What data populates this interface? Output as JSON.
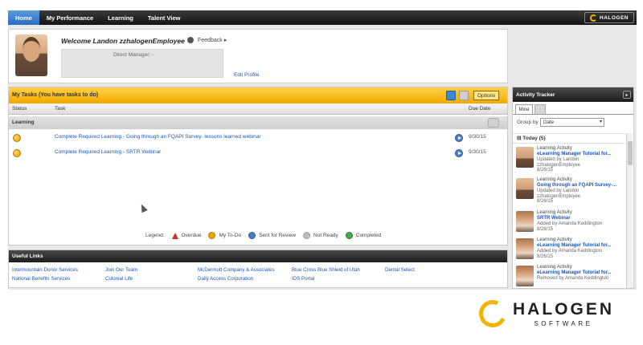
{
  "nav": {
    "tabs": [
      "Home",
      "My Performance",
      "Learning",
      "Talent View"
    ],
    "logo": "HALOGEN"
  },
  "welcome": {
    "title": "Welcome Landon zzhalogenEmployee",
    "feedback": "Feedback",
    "manager_label": "Direct Manager: -",
    "edit_profile": "Edit Profile"
  },
  "tasks": {
    "title": "My Tasks (You have tasks to do)",
    "options": "Options",
    "columns": {
      "status": "Status",
      "task": "Task",
      "due": "Due Date"
    },
    "group": "Learning",
    "rows": [
      {
        "task": "Complete Required Learning - Going through an FQAPI Survey- lessons learned webinar",
        "due": "9/30/15"
      },
      {
        "task": "Complete Required Learning - SRTR Webinar",
        "due": "9/30/15"
      }
    ],
    "legend": {
      "label": "Legend:",
      "overdue": "Overdue",
      "todo": "My To-Do",
      "review": "Sent for Review",
      "not_ready": "Not Ready",
      "completed": "Completed"
    }
  },
  "links": {
    "title": "Useful Links",
    "items": [
      "Intermountain Donor Services",
      "Join Our Team",
      "McDermott Company & Associates",
      "Blue Cross Blue Shield of Utah",
      "Dental Select",
      "National Benefits Services",
      "Colonial Life",
      "Daily Access Corporation",
      "IDS Portal"
    ]
  },
  "tracker": {
    "title": "Activity Tracker",
    "tab_mine": "Mine",
    "group_by_label": "Group by",
    "group_by_value": "Date",
    "today": "Today (5)",
    "items": [
      {
        "type": "Learning Activity",
        "title": "eLearning Manager Tutorial for...",
        "by": "Updated by Landon zzhalogenEmployee",
        "date": "8/26/15"
      },
      {
        "type": "Learning Activity",
        "title": "Going through an FQAPI Survey-...",
        "by": "Updated by Landon zzhalogenEmployee",
        "date": "8/26/15"
      },
      {
        "type": "Learning Activity",
        "title": "SRTR Webinar",
        "by": "Added by Amanda Keddington",
        "date": "8/26/15"
      },
      {
        "type": "Learning Activity",
        "title": "eLearning Manager Tutorial for...",
        "by": "Added by Amanda Keddington",
        "date": "8/26/15"
      },
      {
        "type": "Learning Activity",
        "title": "eLearning Manager Tutorial for...",
        "by": "Removed by Amanda Keddington",
        "date": ""
      }
    ]
  },
  "footer": {
    "brand": "HALOGEN",
    "sub": "SOFTWARE"
  }
}
